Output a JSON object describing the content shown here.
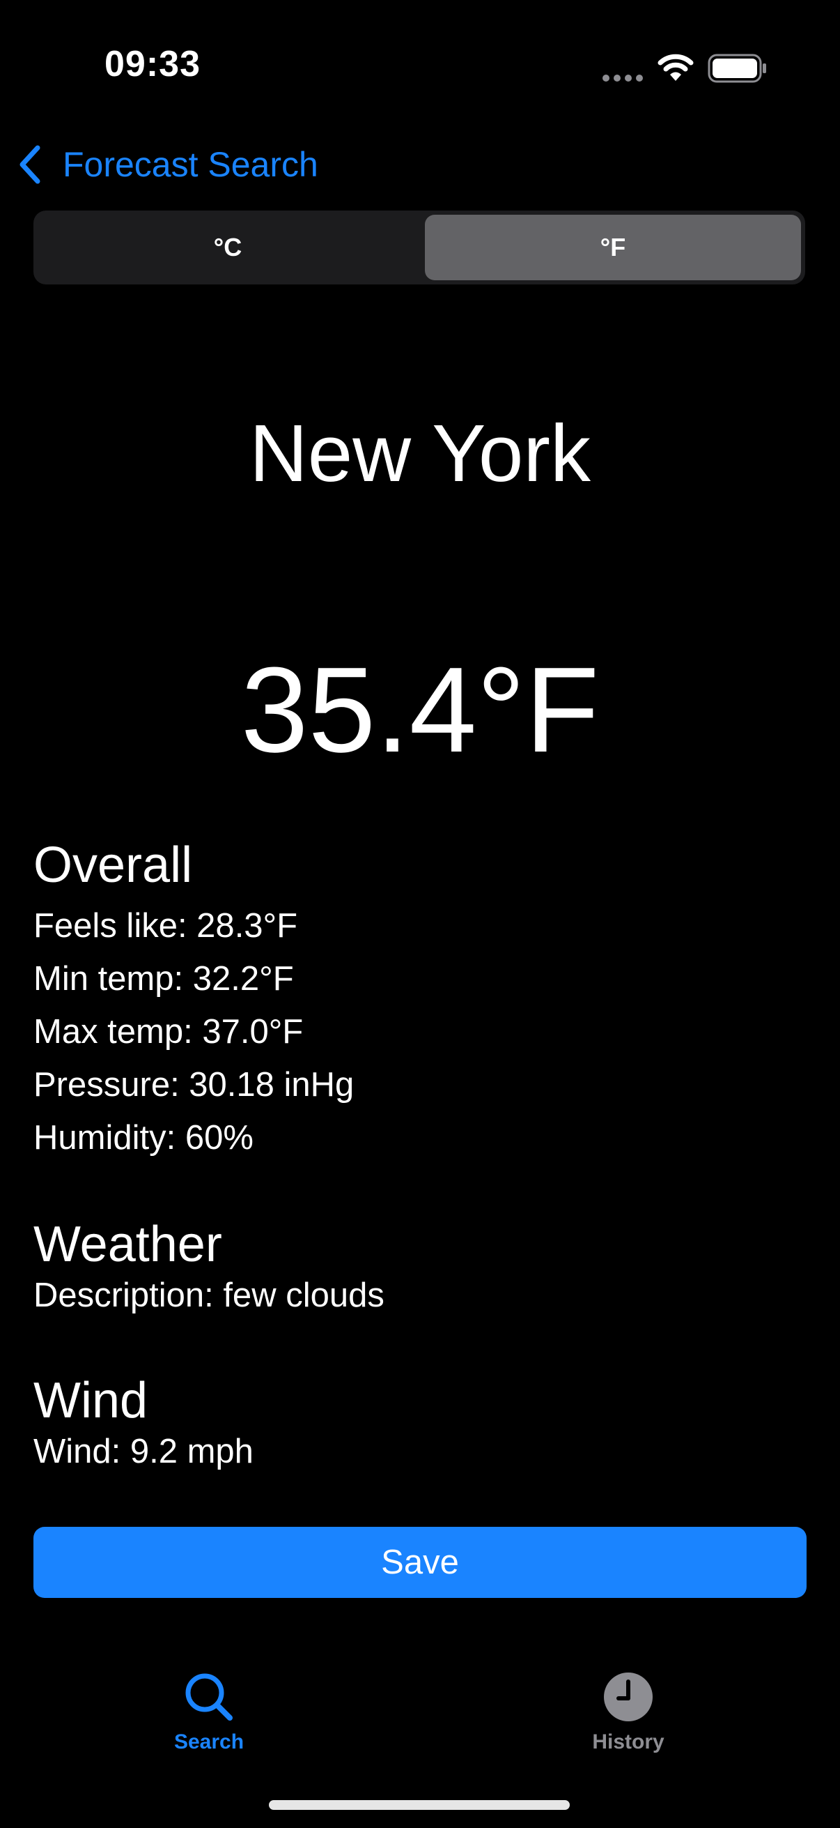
{
  "status_bar": {
    "time": "09:33"
  },
  "nav": {
    "back_label": "Forecast Search"
  },
  "unit_toggle": {
    "options": [
      "°C",
      "°F"
    ],
    "selected": "°F"
  },
  "location": {
    "city": "New York",
    "temperature": "35.4°F"
  },
  "overall": {
    "title": "Overall",
    "lines": [
      "Feels like: 28.3°F",
      "Min temp: 32.2°F",
      "Max temp: 37.0°F",
      "Pressure: 30.18 inHg",
      "Humidity: 60%"
    ]
  },
  "weather": {
    "title": "Weather",
    "description": "Description: few clouds"
  },
  "wind": {
    "title": "Wind",
    "speed": "Wind: 9.2 mph"
  },
  "actions": {
    "save_label": "Save"
  },
  "tab_bar": {
    "tabs": [
      {
        "label": "Search",
        "icon": "search-icon",
        "active": true
      },
      {
        "label": "History",
        "icon": "clock-icon",
        "active": false
      }
    ]
  },
  "colors": {
    "accent": "#1a84ff",
    "background": "#000000",
    "segment_selected": "#636366",
    "segment_track": "#1c1c1e",
    "inactive_tab": "#8e8e93"
  }
}
